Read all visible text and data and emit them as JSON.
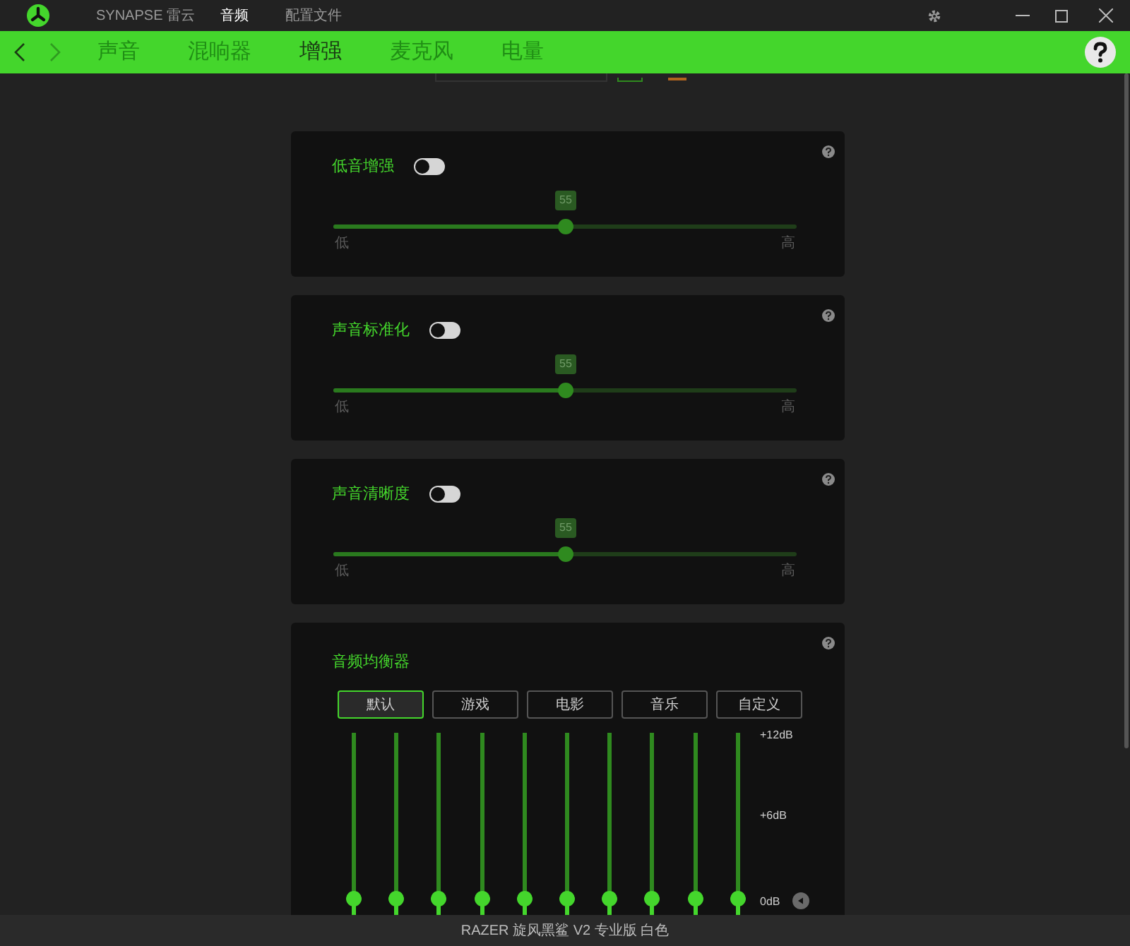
{
  "window": {
    "app_name": "SYNAPSE 雷云",
    "tabs": [
      {
        "label": "音频",
        "selected": true
      },
      {
        "label": "配置文件",
        "selected": false
      }
    ]
  },
  "nav": {
    "back_disabled": false,
    "forward_disabled": true,
    "tabs": [
      {
        "label": "声音",
        "selected": false
      },
      {
        "label": "混响器",
        "selected": false
      },
      {
        "label": "增强",
        "selected": true
      },
      {
        "label": "麦克风",
        "selected": false
      },
      {
        "label": "电量",
        "selected": false
      }
    ]
  },
  "enhancements": [
    {
      "title": "低音增强",
      "on": false,
      "level": 0.5,
      "reading": "55",
      "low": "低",
      "high": "高"
    },
    {
      "title": "声音标准化",
      "on": false,
      "level": 0.5,
      "reading": "55",
      "low": "低",
      "high": "高"
    },
    {
      "title": "声音清晰度",
      "on": false,
      "level": 0.5,
      "reading": "55",
      "low": "低",
      "high": "高"
    }
  ],
  "equalizer": {
    "title": "音频均衡器",
    "presets": [
      {
        "label": "默认",
        "selected": true
      },
      {
        "label": "游戏",
        "selected": false
      },
      {
        "label": "电影",
        "selected": false
      },
      {
        "label": "音乐",
        "selected": false
      },
      {
        "label": "自定义",
        "selected": false
      }
    ],
    "bands": [
      {
        "level": 0.5
      },
      {
        "level": 0.5
      },
      {
        "level": 0.5
      },
      {
        "level": 0.5
      },
      {
        "level": 0.5
      },
      {
        "level": 0.5
      },
      {
        "level": 0.5
      },
      {
        "level": 0.5
      },
      {
        "level": 0.5
      },
      {
        "level": 0.5
      }
    ],
    "scale": [
      "+12dB",
      "+6dB",
      "0dB"
    ]
  },
  "status_bar": "RAZER 旋风黑鲨 V2 专业版 白色"
}
